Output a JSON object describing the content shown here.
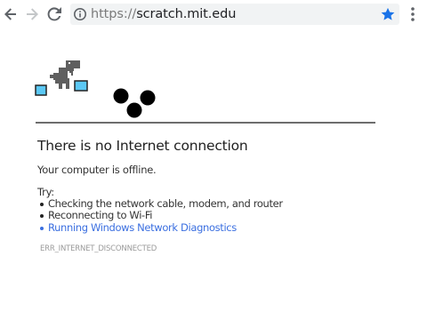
{
  "browser": {
    "url_scheme": "https://",
    "url_host": "scratch.mit.edu",
    "icons": {
      "back": "arrow-left-icon",
      "forward": "arrow-right-icon",
      "reload": "reload-icon",
      "info": "info-icon",
      "bookmark": "star-icon",
      "menu": "kebab-menu-icon"
    },
    "colors": {
      "bookmark_star": "#1a73e8",
      "omnibox_bg": "#f1f3f4"
    }
  },
  "offline_page": {
    "heading": "There is no Internet connection",
    "subtitle": "Your computer is offline.",
    "try_label": "Try:",
    "suggestions": [
      "Checking the network cable, modem, and router",
      "Reconnecting to Wi-Fi",
      "Running Windows Network Diagnostics"
    ],
    "error_code": "ERR_INTERNET_DISCONNECTED",
    "colors": {
      "link": "#3b6fe0",
      "dino": "#5f5f5f",
      "computer_screen": "#5bc8f5"
    }
  }
}
